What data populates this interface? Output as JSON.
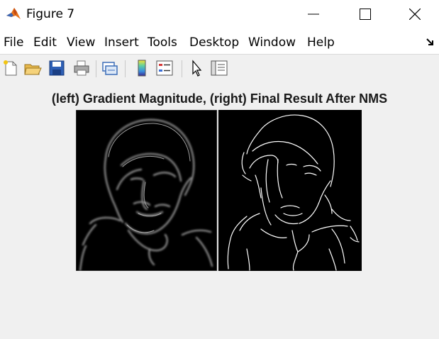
{
  "window": {
    "title": "Figure 7"
  },
  "menu": {
    "items": [
      "File",
      "Edit",
      "View",
      "Insert",
      "Tools",
      "Desktop",
      "Window",
      "Help"
    ]
  },
  "toolbar": {
    "buttons": [
      "new-figure-icon",
      "open-file-icon",
      "save-icon",
      "print-icon",
      "link-plot-icon",
      "colorbar-icon",
      "legend-icon",
      "edit-plot-arrow-icon",
      "property-inspector-icon"
    ]
  },
  "figure": {
    "title": "(left) Gradient Magnitude, (right) Final Result After NMS"
  },
  "colors": {
    "matlab_orange": "#e8731c",
    "matlab_blue": "#3b67b5",
    "figure_background": "#f0f0f0"
  }
}
